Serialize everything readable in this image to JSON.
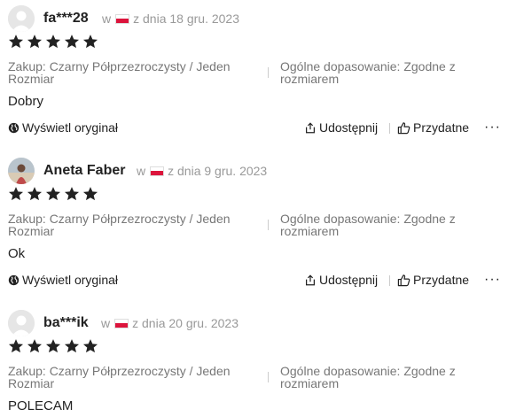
{
  "reviews": [
    {
      "name": "fa***28",
      "avatar": "default-avatar",
      "in_word": "w",
      "date": "z dnia 18 gru. 2023",
      "rating": 5,
      "purchase_line1": "Zakup: Czarny Półprzezroczysty / Jeden",
      "purchase_line2": "Rozmiar",
      "fit_line1": "Ogólne dopasowanie: Zgodne z",
      "fit_line2": "rozmiarem",
      "text": "Dobry",
      "view_original": "Wyświetl oryginał",
      "share": "Udostępnij",
      "helpful": "Przydatne",
      "more": "···"
    },
    {
      "name": "Aneta Faber",
      "avatar": "photo-avatar",
      "in_word": "w",
      "date": "z dnia 9 gru. 2023",
      "rating": 5,
      "purchase_line1": "Zakup: Czarny Półprzezroczysty / Jeden",
      "purchase_line2": "Rozmiar",
      "fit_line1": "Ogólne dopasowanie: Zgodne z",
      "fit_line2": "rozmiarem",
      "text": "Ok",
      "view_original": "Wyświetl oryginał",
      "share": "Udostępnij",
      "helpful": "Przydatne",
      "more": "···"
    },
    {
      "name": "ba***ik",
      "avatar": "default-avatar",
      "in_word": "w",
      "date": "z dnia 20 gru. 2023",
      "rating": 5,
      "purchase_line1": "Zakup: Czarny Półprzezroczysty / Jeden",
      "purchase_line2": "Rozmiar",
      "fit_line1": "Ogólne dopasowanie: Zgodne z",
      "fit_line2": "rozmiarem",
      "text": "POLECAM"
    }
  ],
  "colors": {
    "flag_red": "#dc143c",
    "star": "#222222",
    "muted": "#999999"
  }
}
